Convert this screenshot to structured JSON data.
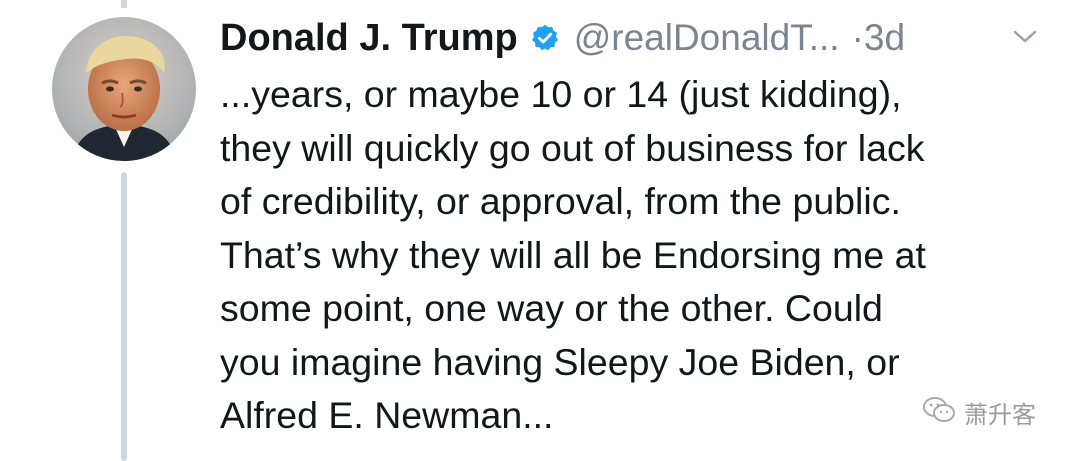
{
  "tweet": {
    "author_name": "Donald J. Trump",
    "handle": "@realDonaldT...",
    "separator": "·",
    "timestamp": "3d",
    "verified": true,
    "text": "...years, or maybe 10 or 14 (just kidding),\nthey will quickly go out of business for lack\nof credibility, or approval, from the public.\nThat’s why they will all be Endorsing me at\nsome point, one way or the other. Could\nyou imagine having Sleepy Joe Biden, or\nAlfred E. Newman..."
  },
  "watermark": {
    "text": "萧升客",
    "icon": "wechat-icon"
  },
  "icons": {
    "verified": "verified-badge-icon",
    "more": "chevron-down-icon"
  },
  "colors": {
    "text": "#14171a",
    "secondary": "#7a8590",
    "verified_blue": "#1da1f2",
    "thread_line": "#cfd6dc"
  }
}
